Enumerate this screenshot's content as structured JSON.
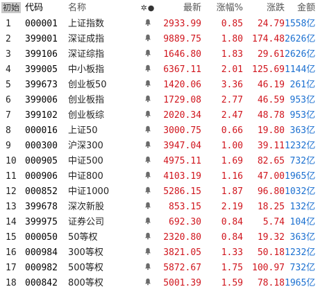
{
  "header": {
    "badge": "初始",
    "code": "代码",
    "name": "名称",
    "icons": "✲●",
    "price": "最新",
    "pct": "涨幅%",
    "chg": "涨跌",
    "amount": "金额"
  },
  "colors": {
    "up": "#d0141c",
    "amount": "#1a6fd0",
    "bell": "#6a6a6a"
  },
  "rows": [
    {
      "idx": "1",
      "code": "000001",
      "name": "上证指数",
      "price": "2933.99",
      "pct": "0.85",
      "chg": "24.79",
      "amount": "1558亿"
    },
    {
      "idx": "2",
      "code": "399001",
      "name": "深证成指",
      "price": "9889.75",
      "pct": "1.80",
      "chg": "174.48",
      "amount": "2626亿"
    },
    {
      "idx": "3",
      "code": "399106",
      "name": "深证综指",
      "price": "1646.80",
      "pct": "1.83",
      "chg": "29.61",
      "amount": "2626亿"
    },
    {
      "idx": "4",
      "code": "399005",
      "name": "中小板指",
      "price": "6367.11",
      "pct": "2.01",
      "chg": "125.69",
      "amount": "1144亿"
    },
    {
      "idx": "5",
      "code": "399673",
      "name": "创业板50",
      "price": "1420.06",
      "pct": "3.36",
      "chg": "46.19",
      "amount": "261亿"
    },
    {
      "idx": "6",
      "code": "399006",
      "name": "创业板指",
      "price": "1729.08",
      "pct": "2.77",
      "chg": "46.59",
      "amount": "953亿"
    },
    {
      "idx": "7",
      "code": "399102",
      "name": "创业板综",
      "price": "2020.34",
      "pct": "2.47",
      "chg": "48.78",
      "amount": "953亿"
    },
    {
      "idx": "8",
      "code": "000016",
      "name": "上证50",
      "price": "3000.75",
      "pct": "0.66",
      "chg": "19.80",
      "amount": "363亿"
    },
    {
      "idx": "9",
      "code": "000300",
      "name": "沪深300",
      "price": "3947.04",
      "pct": "1.00",
      "chg": "39.11",
      "amount": "1232亿"
    },
    {
      "idx": "10",
      "code": "000905",
      "name": "中证500",
      "price": "4975.11",
      "pct": "1.69",
      "chg": "82.65",
      "amount": "732亿"
    },
    {
      "idx": "11",
      "code": "000906",
      "name": "中证800",
      "price": "4103.19",
      "pct": "1.16",
      "chg": "47.00",
      "amount": "1965亿"
    },
    {
      "idx": "12",
      "code": "000852",
      "name": "中证1000",
      "price": "5286.15",
      "pct": "1.87",
      "chg": "96.80",
      "amount": "1032亿"
    },
    {
      "idx": "13",
      "code": "399678",
      "name": "深次新股",
      "price": "853.15",
      "pct": "2.19",
      "chg": "18.25",
      "amount": "132亿"
    },
    {
      "idx": "14",
      "code": "399975",
      "name": "证券公司",
      "price": "692.30",
      "pct": "0.84",
      "chg": "5.74",
      "amount": "104亿"
    },
    {
      "idx": "15",
      "code": "000050",
      "name": "50等权",
      "price": "2320.80",
      "pct": "0.84",
      "chg": "19.32",
      "amount": "363亿"
    },
    {
      "idx": "16",
      "code": "000984",
      "name": "300等权",
      "price": "3821.05",
      "pct": "1.33",
      "chg": "50.18",
      "amount": "1232亿"
    },
    {
      "idx": "17",
      "code": "000982",
      "name": "500等权",
      "price": "5872.67",
      "pct": "1.75",
      "chg": "100.97",
      "amount": "732亿"
    },
    {
      "idx": "18",
      "code": "000842",
      "name": "800等权",
      "price": "5001.39",
      "pct": "1.59",
      "chg": "78.18",
      "amount": "1965亿"
    }
  ]
}
